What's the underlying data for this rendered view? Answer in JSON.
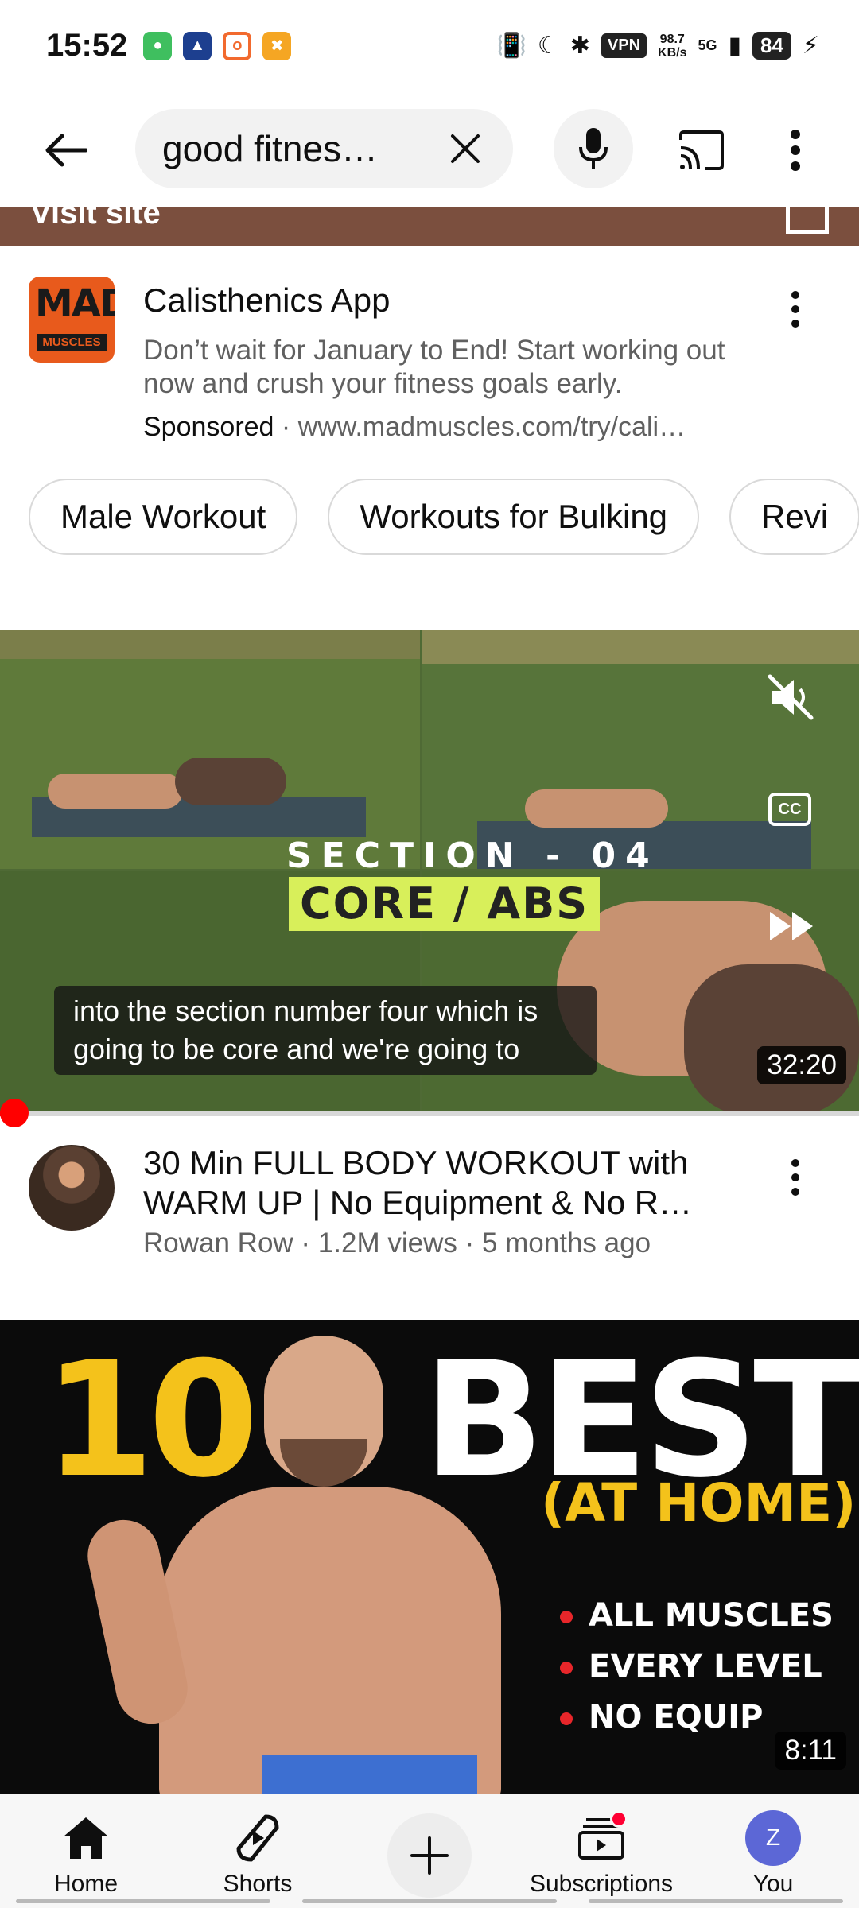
{
  "status_bar": {
    "time": "15:52",
    "vpn": "VPN",
    "net_speed_value": "98.7",
    "net_speed_unit": "KB/s",
    "network": "5G",
    "battery": "84",
    "icons": [
      "vibrate-icon",
      "moon-icon",
      "bluetooth-icon",
      "signal-icon",
      "charging-icon"
    ]
  },
  "search": {
    "query": "good fitnes…"
  },
  "ad": {
    "visit_label": "Visit site",
    "logo_line1": "MAD",
    "logo_line2": "MUSCLES",
    "title": "Calisthenics App",
    "description": "Don’t wait for January to End! Start working out now and crush your fitness goals early.",
    "sponsored": "Sponsored",
    "separator": " · ",
    "url": "www.madmuscles.com/try/cali…"
  },
  "chips": [
    "Male Workout",
    "Workouts for Bulking",
    "Revi"
  ],
  "video1": {
    "overlay_section": "SECTION - 04",
    "overlay_title": "CORE / ABS",
    "caption_line1": "into the section number four which is",
    "caption_line2": "going to be core and we're going to",
    "duration": "32:20",
    "cc_label": "CC",
    "progress": 0.01,
    "title": "30 Min FULL BODY WORKOUT with WARM UP | No Equipment & No R…",
    "meta": "Rowan Row · 1.2M views · 5 months ago"
  },
  "video2": {
    "thumb_number": "10",
    "thumb_word": "BEST",
    "thumb_sub": "(AT HOME)",
    "thumb_bullets": [
      "ALL MUSCLES",
      "EVERY LEVEL",
      "NO EQUIP"
    ],
    "duration": "8:11"
  },
  "bottom_nav": {
    "home": "Home",
    "shorts": "Shorts",
    "subscriptions": "Subscriptions",
    "you": "You",
    "you_initial": "Z"
  },
  "colors": {
    "accent_red": "#ff0000",
    "ad_strip": "#7b4f3e",
    "thumb_yellow": "#f4c21b",
    "avatar_blue": "#5c67d6"
  }
}
